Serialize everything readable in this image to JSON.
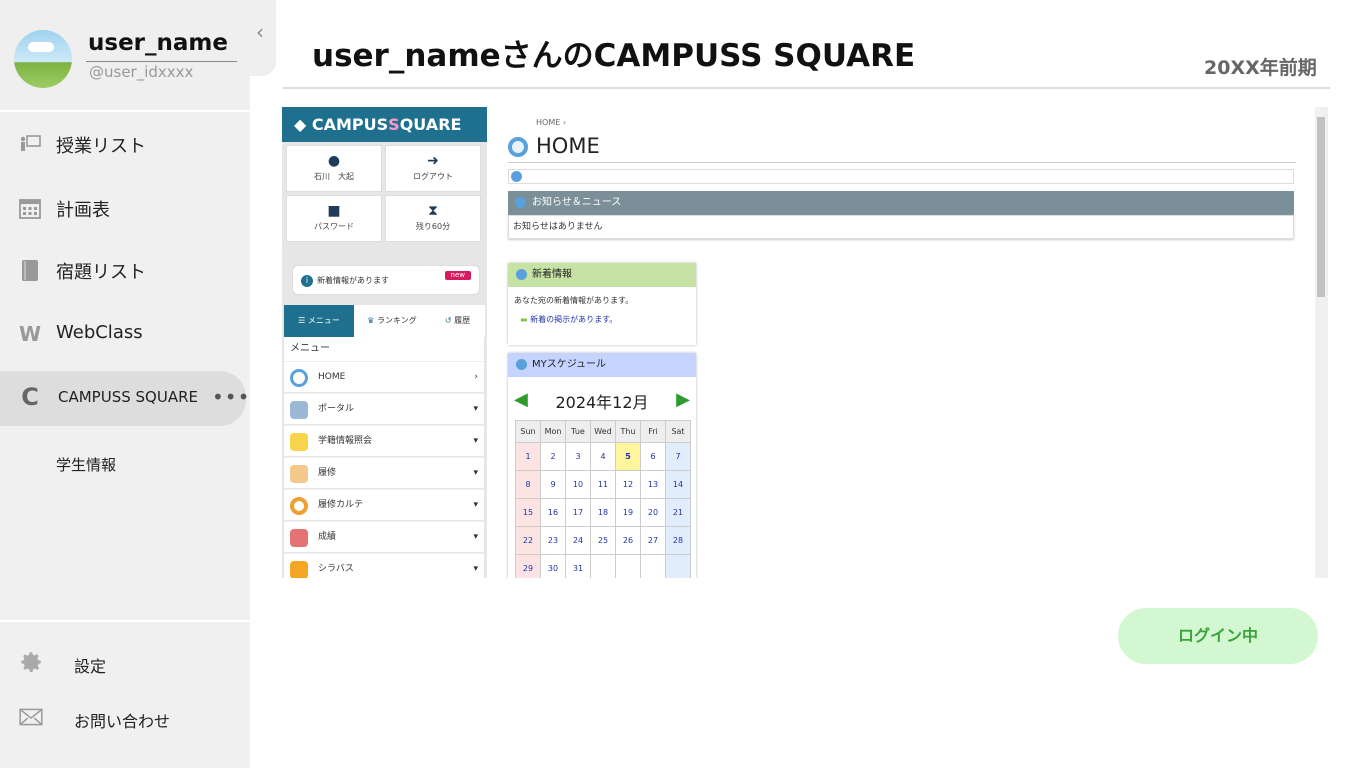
{
  "user": {
    "name": "user_name",
    "id": "@user_idxxxx"
  },
  "sidebar": {
    "items": [
      {
        "label": "授業リスト"
      },
      {
        "label": "計画表"
      },
      {
        "label": "宿題リスト"
      },
      {
        "label": "WebClass",
        "icon_letter": "W"
      },
      {
        "label": "CAMPUSS SQUARE",
        "icon_letter": "C",
        "more": "•••"
      }
    ],
    "sub_item": "学生情報",
    "settings_label": "設定",
    "contact_label": "お問い合わせ",
    "collapse_glyph": "‹"
  },
  "header": {
    "title": "user_nameさんのCAMPUSS SQUARE",
    "term": "20XX年前期"
  },
  "status_button": "ログイン中",
  "colors": {
    "accent_blue": "#1f6f8f",
    "status_green": "#3aa33a",
    "status_bg": "#d3f7d1",
    "sidebar_bg": "#f0f0f0"
  },
  "cs": {
    "logo_pre": "CAMPUS",
    "logo_mid": "S",
    "logo_post": "QUARE",
    "tiles": [
      {
        "label": "石川　大起",
        "icon": "user-icon"
      },
      {
        "label": "ログアウト",
        "icon": "logout-icon"
      },
      {
        "label": "パスワード",
        "icon": "lock-icon"
      },
      {
        "label": "残り60分",
        "icon": "hourglass-icon"
      }
    ],
    "notice": "新着情報があります",
    "notice_badge": "new",
    "tabs": {
      "menu": "メニュー",
      "ranking": "ランキング",
      "history": "履歴"
    },
    "menu_head": "メニュー",
    "menu": [
      {
        "label": "HOME",
        "arrow": "›"
      },
      {
        "label": "ポータル",
        "arrow": "▾"
      },
      {
        "label": "学籍情報照会",
        "arrow": "▾"
      },
      {
        "label": "履修",
        "arrow": "▾"
      },
      {
        "label": "履修カルテ",
        "arrow": "▾"
      },
      {
        "label": "成績",
        "arrow": "▾"
      },
      {
        "label": "シラバス",
        "arrow": "▾"
      }
    ],
    "breadcrumb": "HOME ›",
    "home_title": "HOME",
    "news_head": "お知らせ＆ニュース",
    "news_body": "お知らせはありません",
    "new_info_head": "新着情報",
    "new_info_text": "あなた宛の新着情報があります。",
    "new_info_link": "新着の掲示があります。",
    "schedule_head": "MYスケジュール",
    "calendar": {
      "month": "2024年12月",
      "days": [
        "Sun",
        "Mon",
        "Tue",
        "Wed",
        "Thu",
        "Fri",
        "Sat"
      ],
      "weeks": [
        [
          "1",
          "2",
          "3",
          "4",
          "5",
          "6",
          "7"
        ],
        [
          "8",
          "9",
          "10",
          "11",
          "12",
          "13",
          "14"
        ],
        [
          "15",
          "16",
          "17",
          "18",
          "19",
          "20",
          "21"
        ],
        [
          "22",
          "23",
          "24",
          "25",
          "26",
          "27",
          "28"
        ],
        [
          "29",
          "30",
          "31",
          "",
          "",
          "",
          ""
        ]
      ],
      "today": "5"
    }
  }
}
